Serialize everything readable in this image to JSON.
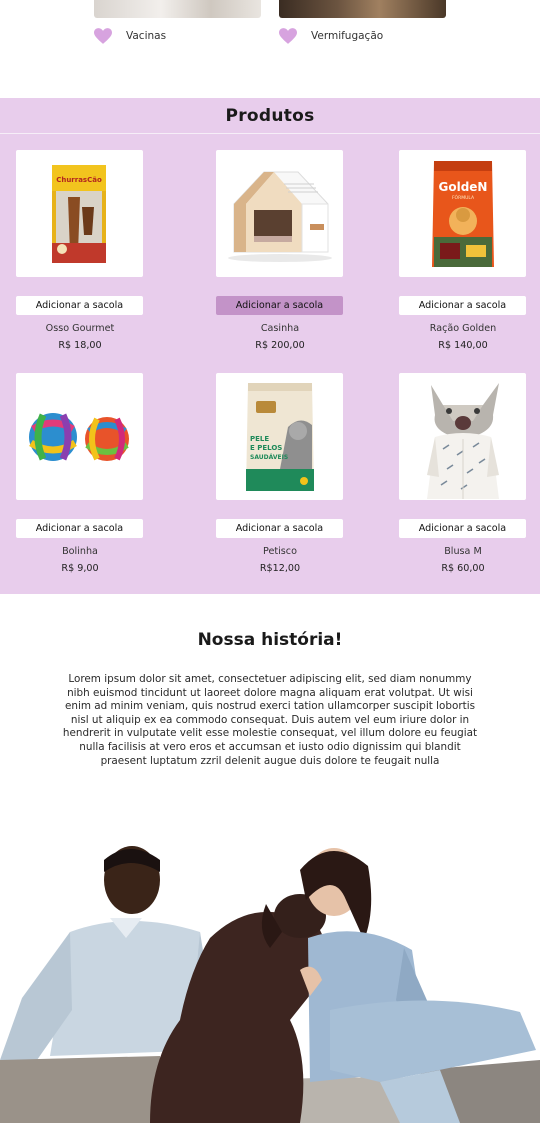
{
  "services": {
    "items": [
      {
        "label": "Vacinas",
        "icon": "heart-icon"
      },
      {
        "label": "Vermifugação",
        "icon": "heart-icon"
      }
    ],
    "accent": "#d7a3df"
  },
  "products": {
    "title": "Produtos",
    "background": "#e8cdec",
    "items": [
      {
        "name": "Osso Gourmet",
        "price": "R$ 18,00",
        "button": "Adicionar a sacola",
        "image": "chew-bone-package",
        "brand": "ChurrasCão"
      },
      {
        "name": "Casinha",
        "price": "R$ 200,00",
        "button": "Adicionar a sacola",
        "image": "pet-house",
        "highlighted": true
      },
      {
        "name": "Ração Golden",
        "price": "R$ 140,00",
        "button": "Adicionar a sacola",
        "image": "dog-food-bag",
        "brand": "GoldeN",
        "brand_sub": "FÓRMULA"
      },
      {
        "name": "Bolinha",
        "price": "R$ 9,00",
        "button": "Adicionar a sacola",
        "image": "knot-balls"
      },
      {
        "name": "Petisco",
        "price": "R$12,00",
        "button": "Adicionar a sacola",
        "image": "cat-treat-pouch",
        "pouch_lines": [
          "PELE",
          "E PELOS",
          "SAUDÁVEIS"
        ]
      },
      {
        "name": "Blusa M",
        "price": "R$ 60,00",
        "button": "Adicionar a sacola",
        "image": "cat-in-shirt"
      }
    ]
  },
  "story": {
    "title": "Nossa história!",
    "text": "Lorem ipsum dolor sit amet, consectetuer adipiscing elit, sed diam nonummy nibh euismod tincidunt ut laoreet dolore magna aliquam erat volutpat. Ut wisi enim ad minim veniam, quis nostrud exerci tation ullamcorper suscipit lobortis nisl ut aliquip ex ea commodo consequat. Duis autem vel eum iriure dolor in hendrerit in vulputate velit esse molestie consequat, vel illum dolore eu feugiat nulla facilisis at vero eros et accumsan et iusto odio dignissim qui blandit praesent luptatum zzril delenit augue duis dolore te feugait nulla"
  }
}
